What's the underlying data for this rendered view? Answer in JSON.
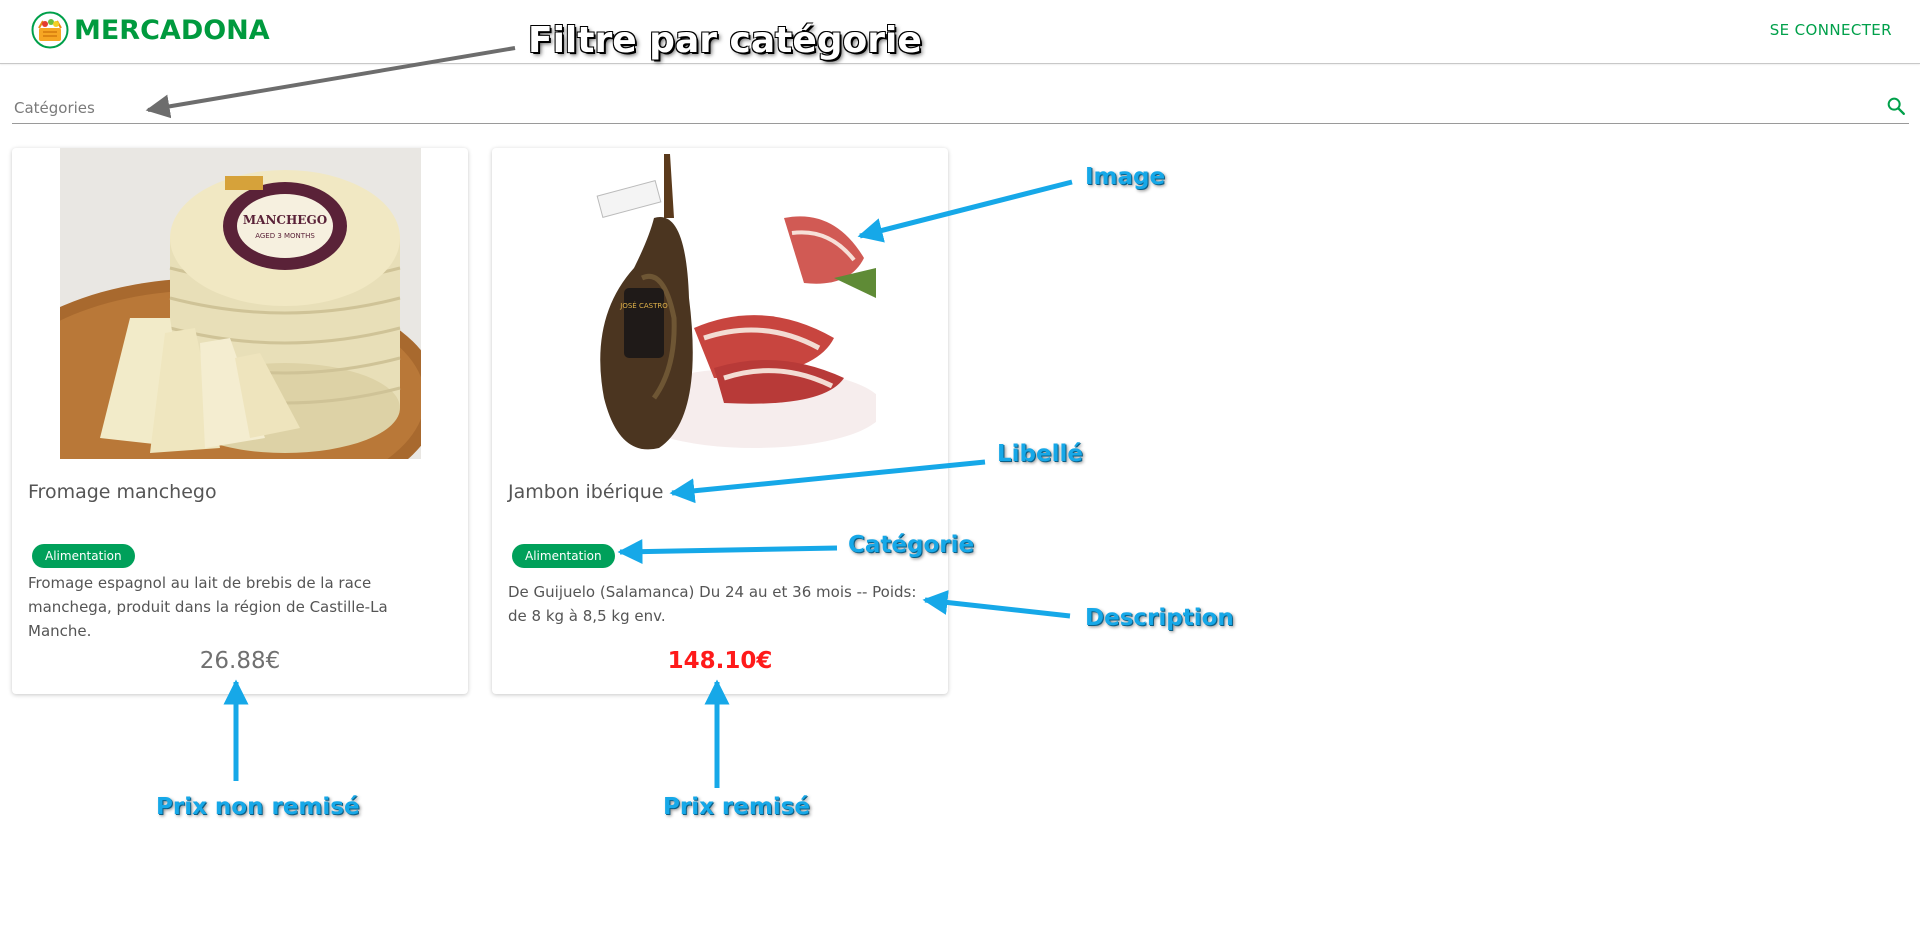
{
  "header": {
    "brand_name": "MERCADONA",
    "login_label": "SE CONNECTER"
  },
  "search": {
    "placeholder": "Catégories"
  },
  "products": [
    {
      "title": "Fromage manchego",
      "category": "Alimentation",
      "description": "Fromage espagnol au lait de brebis de la race manchega, produit dans la région de Castille-La Manche.",
      "price": "26.88€",
      "cheese_label": "MANCHEGO",
      "cheese_sublabel": "AGED 3 MONTHS"
    },
    {
      "title": "Jambon ibérique",
      "category": "Alimentation",
      "description": "De Guijuelo (Salamanca) Du 24 au et 36 mois -- Poids: de 8 kg à 8,5 kg env.",
      "price": "148.10€",
      "ham_label": "JOSÉ CASTRO"
    }
  ],
  "annotations": {
    "filter": "Filtre par catégorie",
    "image": "Image",
    "libelle": "Libellé",
    "categorie": "Catégorie",
    "description": "Description",
    "prix_non_remise": "Prix non remisé",
    "prix_remise": "Prix remisé"
  },
  "colors": {
    "brand_green": "#009a3e",
    "chip_green": "#00a05a",
    "discount_red": "#ff1a1a",
    "annotation_blue": "#16a8e8"
  }
}
